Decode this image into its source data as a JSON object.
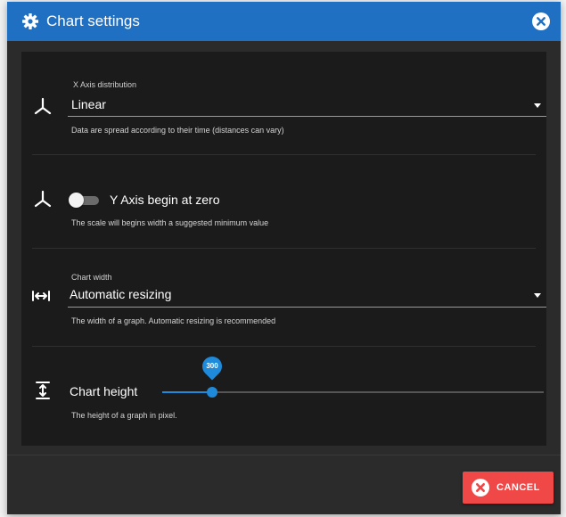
{
  "dialog": {
    "title": "Chart settings",
    "title_icon": "gear-icon",
    "close_icon": "close-circle-icon"
  },
  "x_axis": {
    "label": "X Axis distribution",
    "value": "Linear",
    "helper": "Data are spread according to their time (distances can vary)",
    "icon": "axis-icon"
  },
  "y_axis": {
    "label": "Y Axis begin at zero",
    "enabled": false,
    "helper": "The scale will begins width a suggested minimum value",
    "icon": "axis-icon"
  },
  "chart_width": {
    "label": "Chart width",
    "value": "Automatic resizing",
    "helper": "The width of a graph. Automatic resizing is recommended",
    "icon": "horizontal-resize-icon"
  },
  "chart_height": {
    "label": "Chart height",
    "value": "300",
    "fraction": 0.13,
    "helper": "The height of a graph in pixel.",
    "icon": "vertical-resize-icon"
  },
  "footer": {
    "cancel_label": "CANCEL",
    "cancel_icon": "cancel-circle-icon"
  },
  "colors": {
    "header": "#1f6fc2",
    "accent": "#1f8ad9",
    "cancel": "#f04747"
  }
}
